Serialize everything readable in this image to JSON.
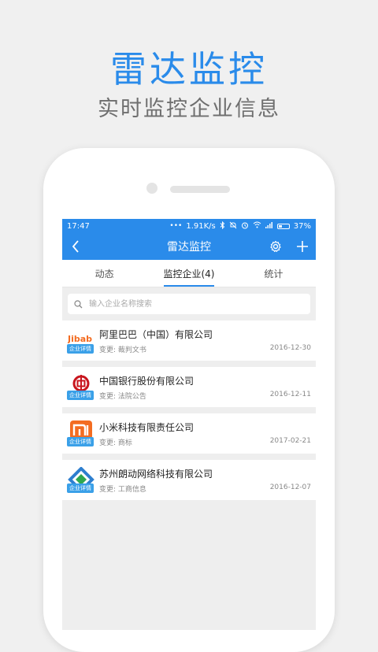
{
  "promo": {
    "title": "雷达监控",
    "subtitle": "实时监控企业信息"
  },
  "status_bar": {
    "time": "17:47",
    "network_speed": "1.91K/s",
    "battery": "37%",
    "battery_level": 0.37
  },
  "navbar": {
    "title": "雷达监控"
  },
  "tabs": [
    {
      "label": "动态"
    },
    {
      "label": "监控企业(4)"
    },
    {
      "label": "统计"
    }
  ],
  "search": {
    "placeholder": "输入企业名称搜索"
  },
  "badge_label": "企业详情",
  "companies": [
    {
      "name": "阿里巴巴（中国）有限公司",
      "change": "变更: 裁判文书",
      "date": "2016-12-30",
      "logo": "alibaba-logo",
      "logo_text": "Jibab"
    },
    {
      "name": "中国银行股份有限公司",
      "change": "变更: 法院公告",
      "date": "2016-12-11",
      "logo": "boc-logo"
    },
    {
      "name": "小米科技有限责任公司",
      "change": "变更: 商标",
      "date": "2017-02-21",
      "logo": "xiaomi-logo"
    },
    {
      "name": "苏州朗动网络科技有限公司",
      "change": "变更: 工商信息",
      "date": "2016-12-07",
      "logo": "langdong-logo"
    }
  ],
  "colors": {
    "brand_blue": "#2a8bea",
    "badge_blue": "#3aa0e8",
    "xiaomi_orange": "#f36c21",
    "boc_red": "#c8161e"
  }
}
